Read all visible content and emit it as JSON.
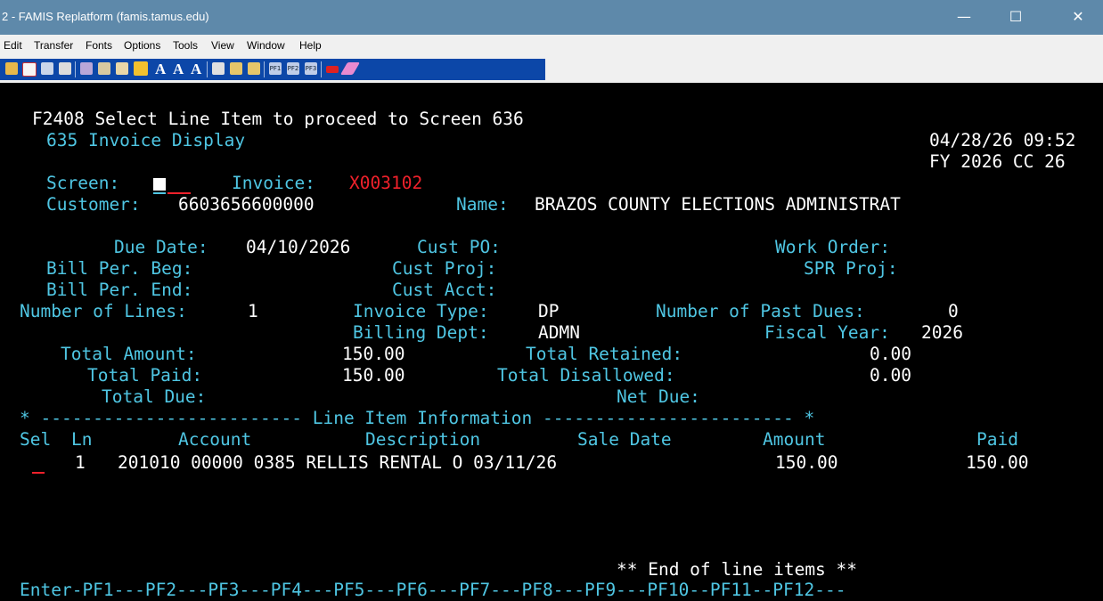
{
  "window": {
    "title": "2 - FAMIS Replatform (famis.tamus.edu)",
    "minimize": "—",
    "maximize": "☐",
    "close": "✕"
  },
  "menu": [
    "Edit",
    "Transfer",
    "Fonts",
    "Options",
    "Tools",
    "View",
    "Window",
    "Help"
  ],
  "toolbar_icons": [
    "new-session-icon",
    "open-icon",
    "properties-icon",
    "print-icon",
    "cut-icon",
    "copy-icon",
    "paste-icon",
    "transfer-icon",
    "font-A-icon",
    "font-A-smaller-icon",
    "font-A-larger-icon",
    "setup-icon",
    "send-file-icon",
    "receive-file-icon",
    "pf1-icon",
    "pf2-icon",
    "pf3-icon",
    "enter-icon",
    "clear-icon"
  ],
  "toolbar_glyphs": {
    "a1": "A",
    "a2": "A",
    "a3": "A",
    "pf1": "PF1",
    "pf2": "PF2",
    "pf3": "PF3"
  },
  "colors": {
    "field_label": "#4fc6e3",
    "field_value": "#ffffff",
    "highlight": "#f0212b",
    "titlebar": "#5e89aa"
  },
  "screen": {
    "message": "F2408 Select Line Item to proceed to Screen 636",
    "title": "635 Invoice Display",
    "datetime": "04/28/26 09:52",
    "fy": "FY 2026 CC 26",
    "screen_label": "Screen:",
    "invoice_label": "Invoice:",
    "invoice_value": "X003102",
    "customer_label": "Customer:",
    "customer_value": "6603656600000",
    "name_label": "Name:",
    "name_value": "BRAZOS COUNTY ELECTIONS ADMINISTRAT",
    "due_date_label": "Due Date:",
    "due_date_value": "04/10/2026",
    "cust_po_label": "Cust PO:",
    "work_order_label": "Work Order:",
    "bill_beg_label": "Bill Per. Beg:",
    "cust_proj_label": "Cust Proj:",
    "spr_proj_label": "SPR Proj:",
    "bill_end_label": "Bill Per. End:",
    "cust_acct_label": "Cust Acct:",
    "num_lines_label": "Number of Lines:",
    "num_lines_value": "1",
    "invoice_type_label": "Invoice Type:",
    "invoice_type_value": "DP",
    "past_dues_label": "Number of Past Dues:",
    "past_dues_value": "0",
    "billing_dept_label": "Billing Dept:",
    "billing_dept_value": "ADMN",
    "fiscal_year_label": "Fiscal Year:",
    "fiscal_year_value": "2026",
    "total_amount_label": "Total Amount:",
    "total_amount_value": "150.00",
    "total_retained_label": "Total Retained:",
    "total_retained_value": "0.00",
    "total_paid_label": "Total Paid:",
    "total_paid_value": "150.00",
    "total_disallowed_label": "Total Disallowed:",
    "total_disallowed_value": "0.00",
    "total_due_label": "Total Due:",
    "net_due_label": "Net Due:",
    "separator": "* ------------------------- Line Item Information ------------------------ *",
    "columns": {
      "sel": "Sel",
      "ln": "Ln",
      "account": "Account",
      "description": "Description",
      "sale_date": "Sale Date",
      "amount": "Amount",
      "paid": "Paid"
    },
    "lines": [
      {
        "ln": "1",
        "detail": "201010 00000 0385 RELLIS RENTAL O 03/11/26",
        "amount": "150.00",
        "paid": "150.00"
      }
    ],
    "end_marker": "** End of line items **",
    "pf_keys": "Enter-PF1---PF2---PF3---PF4---PF5---PF6---PF7---PF8---PF9---PF10--PF11--PF12---"
  }
}
